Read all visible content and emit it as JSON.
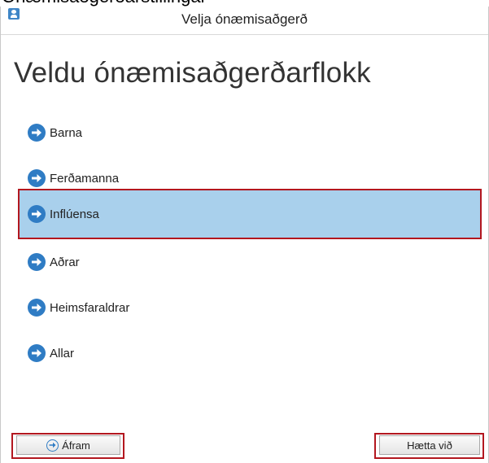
{
  "window": {
    "title": "Velja ónæmisaðgerð",
    "cut_text": "Ónæmisaðgerðarstillingar"
  },
  "heading": "Veldu ónæmisaðgerðarflokk",
  "options": [
    {
      "label": "Barna",
      "selected": false
    },
    {
      "label": "Ferðamanna",
      "selected": false
    },
    {
      "label": "Inflúensa",
      "selected": true
    },
    {
      "label": "Aðrar",
      "selected": false
    },
    {
      "label": "Heimsfaraldrar",
      "selected": false
    },
    {
      "label": "Allar",
      "selected": false
    }
  ],
  "buttons": {
    "next_label": "Áfram",
    "cancel_label": "Hætta við"
  },
  "colors": {
    "selected_bg": "#a9d0ec",
    "highlight_border": "#b3171f",
    "accent": "#2f7cc4"
  }
}
